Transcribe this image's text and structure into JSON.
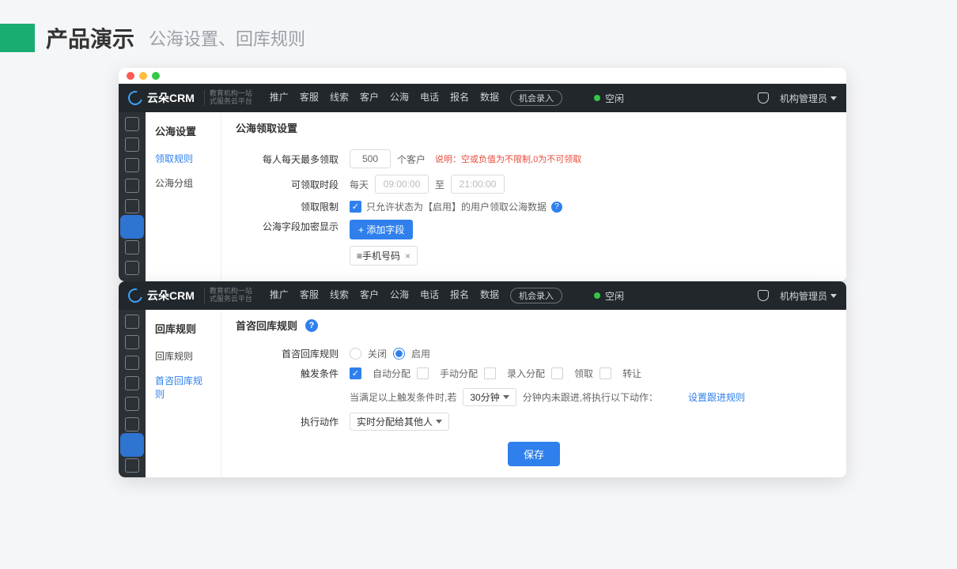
{
  "slide": {
    "title": "产品演示",
    "subtitle": "公海设置、回库规则"
  },
  "brand": {
    "name": "云朵CRM",
    "tagline1": "教育机构一站",
    "tagline2": "式服务云平台"
  },
  "topnav": {
    "items": [
      "推广",
      "客服",
      "线索",
      "客户",
      "公海",
      "电话",
      "报名",
      "数据"
    ],
    "action_pill": "机会录入",
    "status": "空闲",
    "role": "机构管理员"
  },
  "window1": {
    "side_title": "公海设置",
    "side_items": [
      "领取规则",
      "公海分组"
    ],
    "side_active": 0,
    "section_title": "公海领取设置",
    "row_limit": {
      "label": "每人每天最多领取",
      "value": "500",
      "suffix": "个客户",
      "note_prefix": "说明：",
      "note": "空或负值为不限制,0为不可领取"
    },
    "row_time": {
      "label": "可领取时段",
      "daily": "每天",
      "from": "09:00:00",
      "to_word": "至",
      "to": "21:00:00"
    },
    "row_restrict": {
      "label": "领取限制",
      "text": "只允许状态为【启用】的用户领取公海数据"
    },
    "row_encrypt": {
      "label": "公海字段加密显示",
      "add_btn": "+ 添加字段",
      "chip": "≡手机号码",
      "chip_x": "×"
    }
  },
  "window2": {
    "side_title": "回库规则",
    "side_items": [
      "回库规则",
      "首咨回库规则"
    ],
    "side_active": 1,
    "section_title": "首咨回库规则",
    "row_rule": {
      "label": "首咨回库规则",
      "off": "关闭",
      "on": "启用"
    },
    "row_trigger": {
      "label": "触发条件",
      "opts": [
        "自动分配",
        "手动分配",
        "录入分配",
        "领取",
        "转让"
      ],
      "checked": [
        true,
        false,
        false,
        false,
        false
      ],
      "sentence_a": "当满足以上触发条件时,若",
      "duration": "30分钟",
      "sentence_b": "分钟内未跟进,将执行以下动作：",
      "link": "设置跟进规则"
    },
    "row_action": {
      "label": "执行动作",
      "select": "实时分配给其他人"
    },
    "save_btn": "保存"
  }
}
